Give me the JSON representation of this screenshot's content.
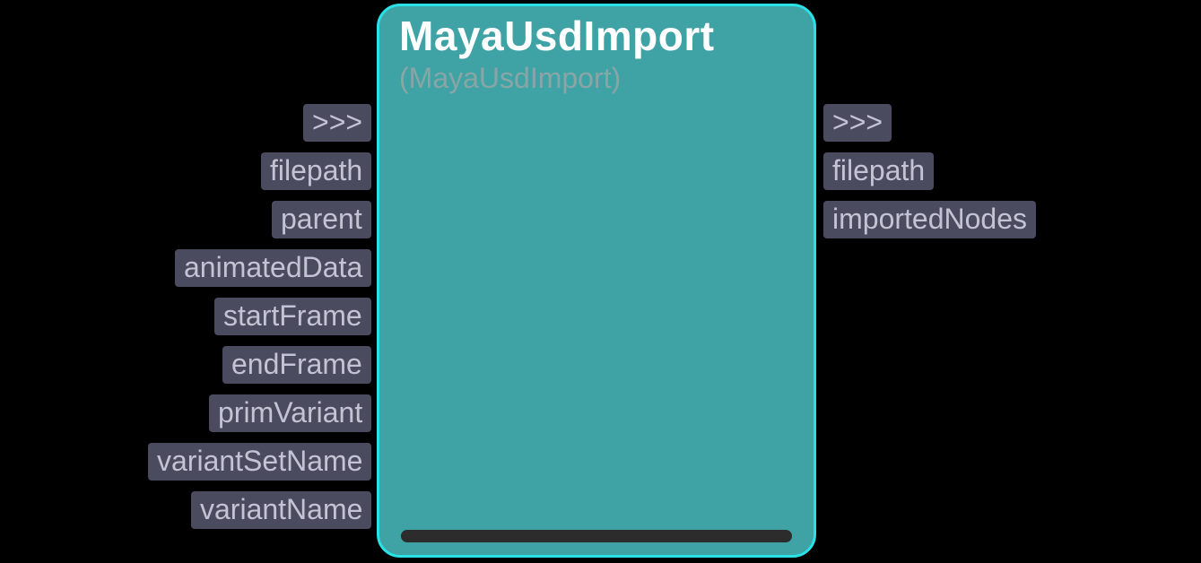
{
  "node": {
    "title": "MayaUsdImport",
    "subtitle": "(MayaUsdImport)"
  },
  "inputs": [
    {
      "label": ">>>"
    },
    {
      "label": "filepath"
    },
    {
      "label": "parent"
    },
    {
      "label": "animatedData"
    },
    {
      "label": "startFrame"
    },
    {
      "label": "endFrame"
    },
    {
      "label": "primVariant"
    },
    {
      "label": "variantSetName"
    },
    {
      "label": "variantName"
    }
  ],
  "outputs": [
    {
      "label": ">>>"
    },
    {
      "label": "filepath"
    },
    {
      "label": "importedNodes"
    }
  ],
  "layout": {
    "portStartY": 116,
    "portStepY": 54,
    "inRightEdge": 414,
    "outLeftEdge": 918
  }
}
